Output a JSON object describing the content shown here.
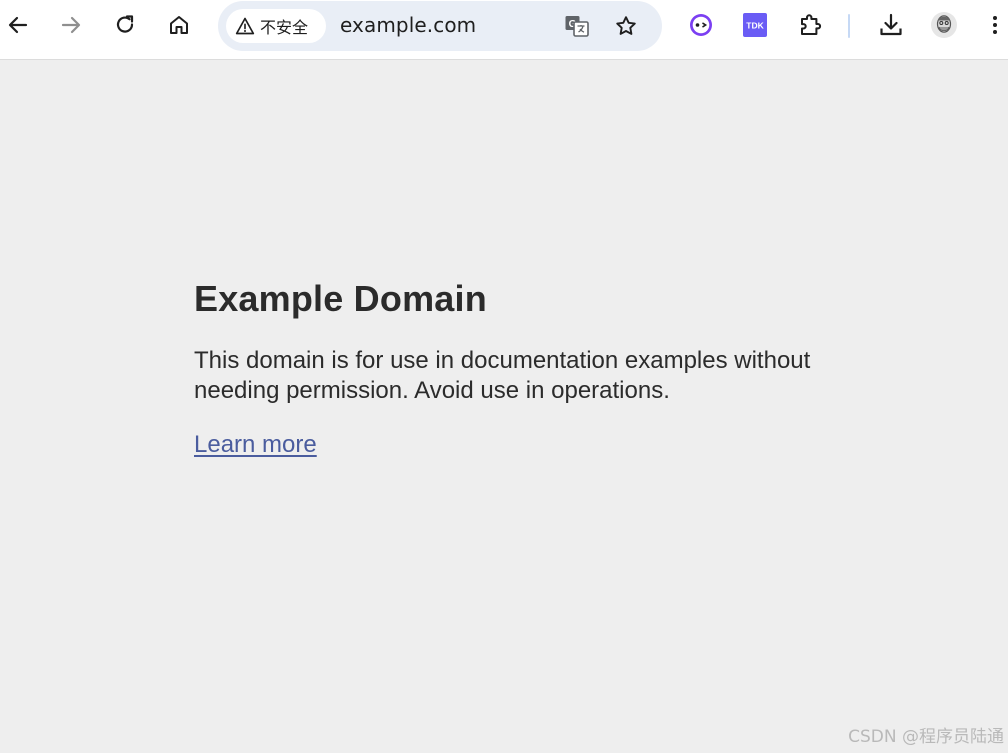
{
  "browser": {
    "security_label": "不安全",
    "url": "example.com",
    "colors": {
      "toolbar_bg": "#ffffff",
      "omnibox_bg": "#e9eef6",
      "page_bg": "#eeeeee",
      "link": "#4a5c9e"
    },
    "icons": {
      "back": "arrow-left-icon",
      "forward": "arrow-right-icon",
      "reload": "reload-icon",
      "home": "home-icon",
      "warning": "warning-triangle-icon",
      "translate": "translate-icon",
      "bookmark": "star-icon",
      "ext1": "extension-eyes-icon",
      "ext2": "tdk-extension-icon",
      "extensions": "puzzle-icon",
      "download": "download-icon",
      "profile": "avatar-icon",
      "menu": "kebab-menu-icon"
    },
    "tdk_label": "TDK"
  },
  "page": {
    "title": "Example Domain",
    "text": "This domain is for use in documentation examples without needing permission. Avoid use in operations.",
    "link_label": "Learn more"
  },
  "watermark": "CSDN @程序员陆通"
}
